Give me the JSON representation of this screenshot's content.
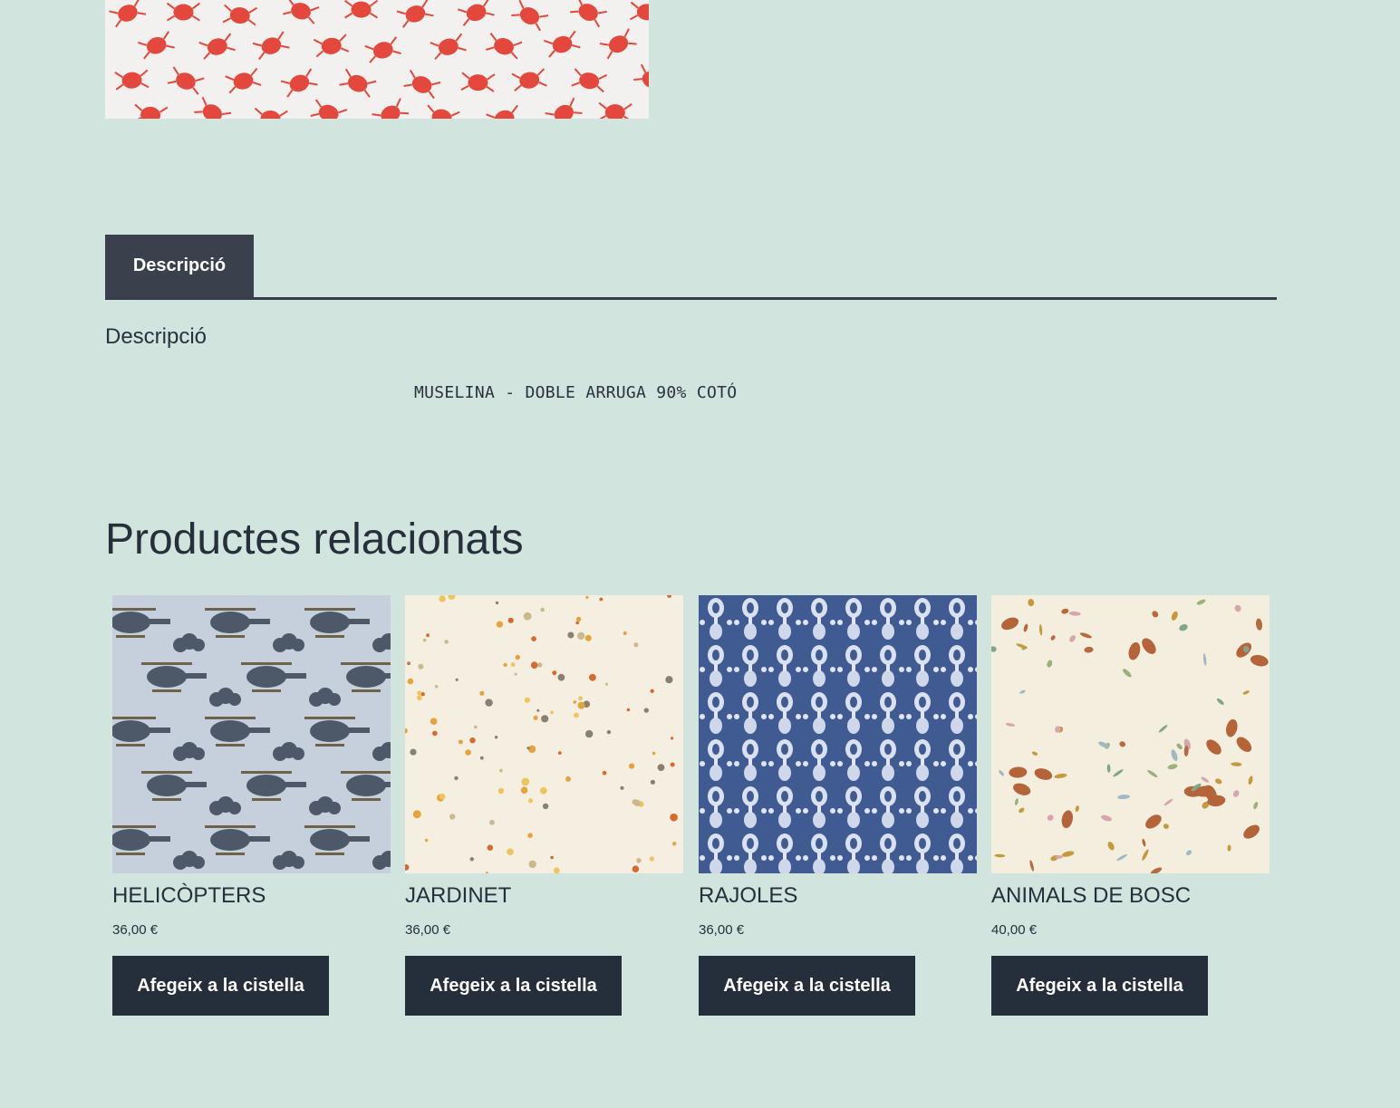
{
  "colors": {
    "background": "#d1e4de",
    "dark": "#252e3b",
    "tab": "#3a414c",
    "text": "#26303b"
  },
  "tabs": [
    {
      "label": "Descripció",
      "active": true
    }
  ],
  "description": {
    "heading": "Descripció",
    "body": "MUSELINA - DOBLE ARRUGA 90% COTÓ"
  },
  "related": {
    "heading": "Productes relacionats",
    "products": [
      {
        "name": "HELICÒPTERS",
        "price": "36,00 €",
        "button": "Afegeix a la cistella",
        "image": "helicopters-fabric-image"
      },
      {
        "name": "JARDINET",
        "price": "36,00 €",
        "button": "Afegeix a la cistella",
        "image": "floral-fabric-image"
      },
      {
        "name": "RAJOLES",
        "price": "36,00 €",
        "button": "Afegeix a la cistella",
        "image": "tiles-fabric-image"
      },
      {
        "name": "ANIMALS DE BOSC",
        "price": "40,00 €",
        "button": "Afegeix a la cistella",
        "image": "forest-animals-fabric-image"
      }
    ]
  }
}
